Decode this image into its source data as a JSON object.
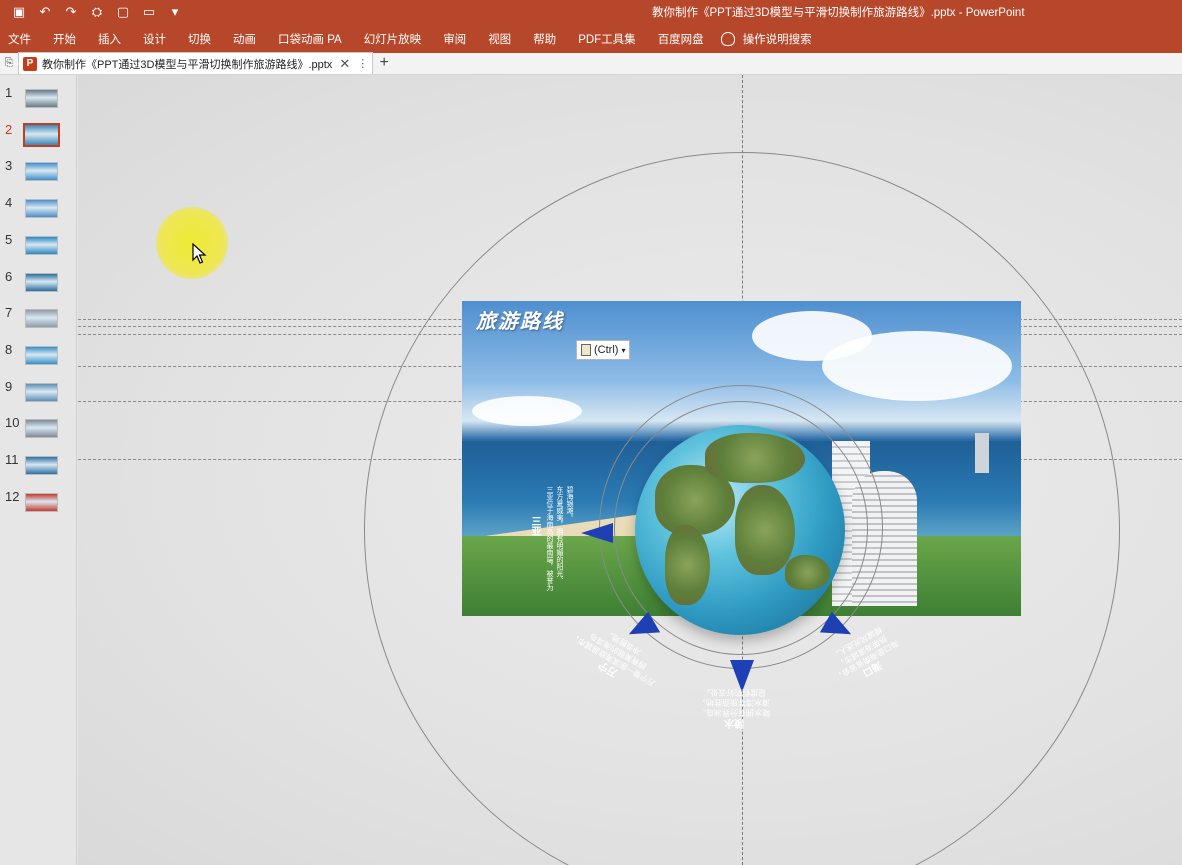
{
  "quick_access": {
    "icons": [
      "save-icon",
      "undo-icon",
      "redo-icon",
      "slideshow-icon",
      "new-icon",
      "open-icon",
      "customize-icon"
    ],
    "glyphs": [
      "▣",
      "↶",
      "↷",
      "⛭",
      "▢",
      "▭",
      "▾"
    ]
  },
  "window_title": "教你制作《PPT通过3D模型与平滑切换制作旅游路线》.pptx  -  PowerPoint",
  "ribbon_tabs": [
    "文件",
    "开始",
    "插入",
    "设计",
    "切换",
    "动画",
    "口袋动画 PA",
    "幻灯片放映",
    "审阅",
    "视图",
    "帮助",
    "PDF工具集",
    "百度网盘"
  ],
  "tell_me": "操作说明搜索",
  "doc_tab": {
    "label": "教你制作《PPT通过3D模型与平滑切换制作旅游路线》.pptx",
    "close": "✕",
    "more": "⋮",
    "new_tab": "+"
  },
  "slides": {
    "selected": 2,
    "items": [
      {
        "num": "1",
        "color": "#6a7a86"
      },
      {
        "num": "2",
        "color": "#3a86b8"
      },
      {
        "num": "3",
        "color": "#3f8ecb"
      },
      {
        "num": "4",
        "color": "#4b8fc8"
      },
      {
        "num": "5",
        "color": "#2d88c6"
      },
      {
        "num": "6",
        "color": "#2a6ea0"
      },
      {
        "num": "7",
        "color": "#8f9ba6"
      },
      {
        "num": "8",
        "color": "#3690c8"
      },
      {
        "num": "9",
        "color": "#5d8fb4"
      },
      {
        "num": "10",
        "color": "#7f8a96"
      },
      {
        "num": "11",
        "color": "#2f6fa4"
      },
      {
        "num": "12",
        "color": "#c83a2c"
      }
    ]
  },
  "slide": {
    "title": "旅游路线",
    "paste_options": "(Ctrl)",
    "left_heading": "三亚",
    "left_text": [
      "三亚位于海南岛的最南端，被誉为",
      "东方夏威夷，拥有明媚的阳光、",
      "碧海银滩。"
    ],
    "bottom_left_heading": "万宁",
    "bottom_left_text": [
      "万宁是一座滨海旅游城市，",
      "拥有美丽的海湾与",
      "冲浪胜地。"
    ],
    "bottom_center_heading": "陵水",
    "bottom_center_text": [
      "陵水拥有分界洲岛、",
      "清水湾等旅游胜地，",
      "是度假的好去处。"
    ],
    "bottom_right_heading": "海口",
    "bottom_right_text": [
      "海口是海南省省会，",
      "热带海滨城市，",
      "椰城风光迷人。"
    ]
  },
  "colors": {
    "accent": "#b7472a",
    "arrow_blue": "#1f3fb4"
  }
}
